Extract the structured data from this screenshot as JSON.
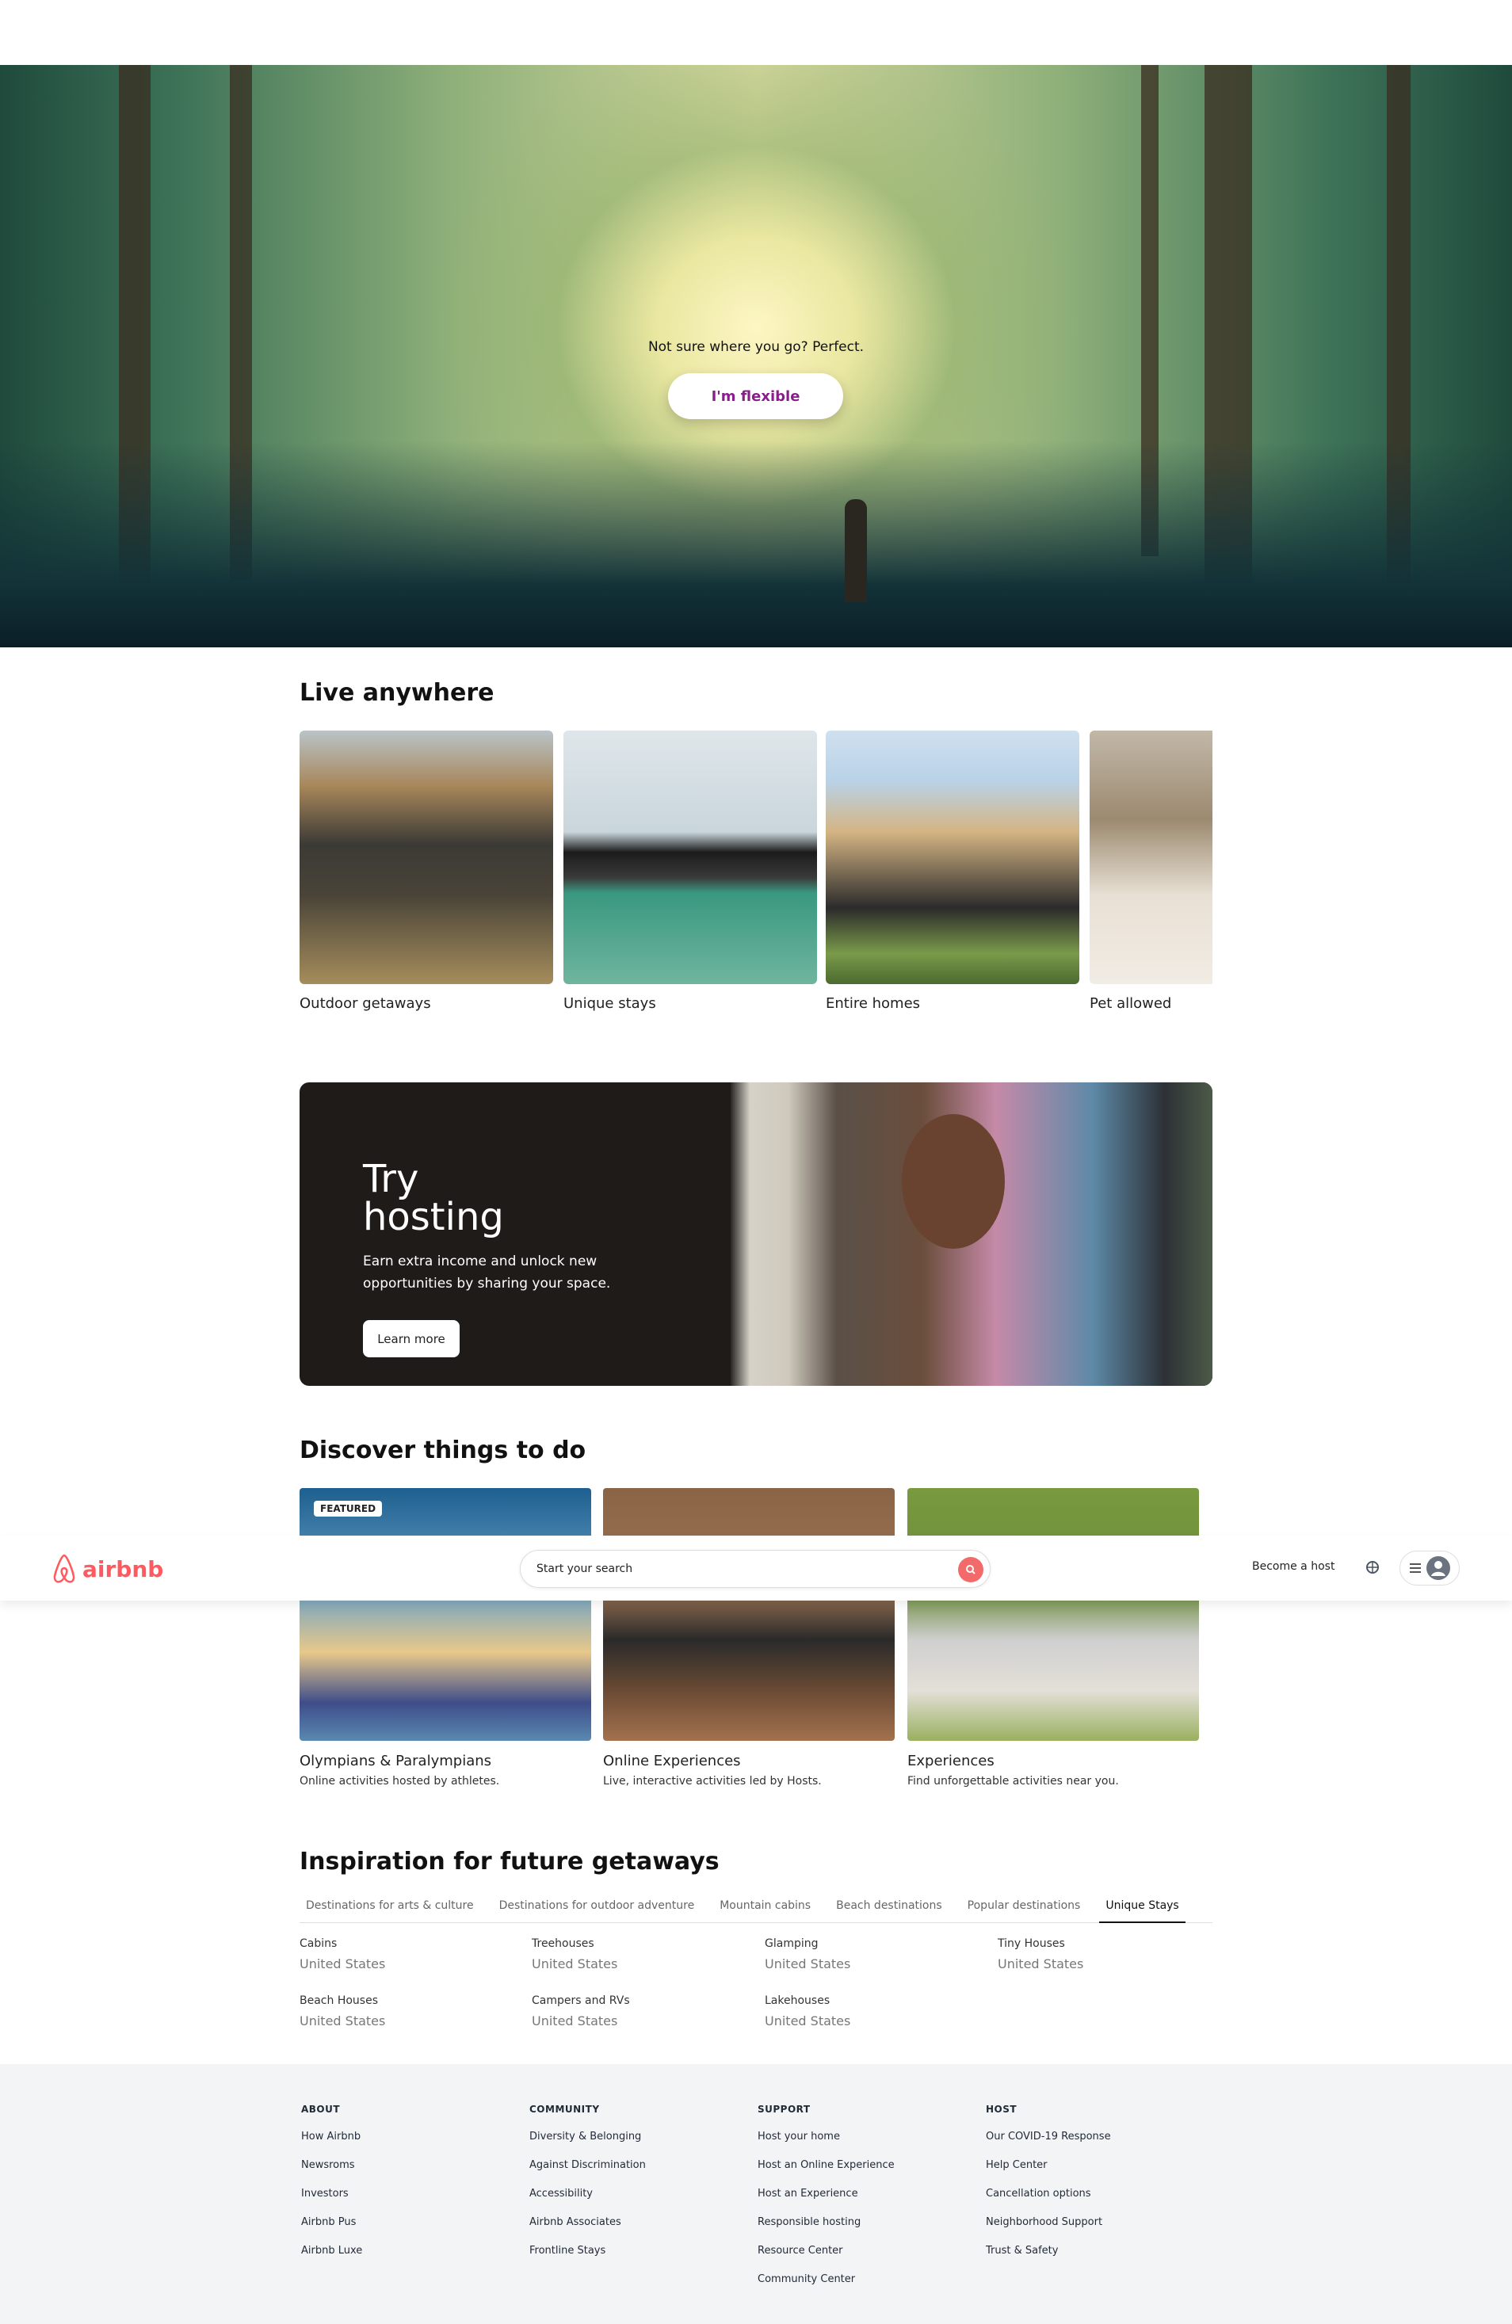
{
  "hero": {
    "tagline": "Not sure where you go? Perfect.",
    "button": "I'm flexible"
  },
  "live": {
    "title": "Live anywhere",
    "cards": [
      {
        "label": "Outdoor getaways"
      },
      {
        "label": "Unique stays"
      },
      {
        "label": "Entire homes"
      },
      {
        "label": "Pet allowed"
      }
    ]
  },
  "hosting": {
    "title": "Try hosting",
    "text": "Earn extra income and unlock new opportunities by sharing your space.",
    "button": "Learn more"
  },
  "discover": {
    "title": "Discover things to do",
    "badge": "FEATURED",
    "cards": [
      {
        "title": "Olympians & Paralympians",
        "sub": "Online activities hosted by athletes."
      },
      {
        "title": "Online Experiences",
        "sub": "Live, interactive activities led by Hosts."
      },
      {
        "title": "Experiences",
        "sub": "Find unforgettable activities near you."
      }
    ]
  },
  "nav": {
    "logo": "airbnb",
    "search_placeholder": "Start your search",
    "become_host": "Become a host",
    "brand_color": "#ff5a5f"
  },
  "inspiration": {
    "title": "Inspiration for future getaways",
    "tabs": [
      "Destinations for arts & culture",
      "Destinations for outdoor adventure",
      "Mountain cabins",
      "Beach destinations",
      "Popular destinations",
      "Unique Stays"
    ],
    "active_tab": "Unique Stays",
    "items": [
      {
        "name": "Cabins",
        "region": "United States"
      },
      {
        "name": "Treehouses",
        "region": "United States"
      },
      {
        "name": "Glamping",
        "region": "United States"
      },
      {
        "name": "Tiny Houses",
        "region": "United States"
      },
      {
        "name": "Beach Houses",
        "region": "United States"
      },
      {
        "name": "Campers and RVs",
        "region": "United States"
      },
      {
        "name": "Lakehouses",
        "region": "United States"
      }
    ]
  },
  "footer": {
    "columns": [
      {
        "title": "ABOUT",
        "links": [
          "How Airbnb",
          "Newsroms",
          "Investors",
          "Airbnb Pus",
          "Airbnb Luxe"
        ]
      },
      {
        "title": "COMMUNITY",
        "links": [
          "Diversity & Belonging",
          "Against Discrimination",
          "Accessibility",
          "Airbnb Associates",
          "Frontline Stays"
        ]
      },
      {
        "title": "SUPPORT",
        "links": [
          "Host your home",
          "Host an Online Experience",
          "Host an Experience",
          "Responsible hosting",
          "Resource Center",
          "Community Center"
        ]
      },
      {
        "title": "HOST",
        "links": [
          "Our COVID-19 Response",
          "Help Center",
          "Cancellation options",
          "Neighborhood Support",
          "Trust & Safety"
        ]
      }
    ]
  }
}
